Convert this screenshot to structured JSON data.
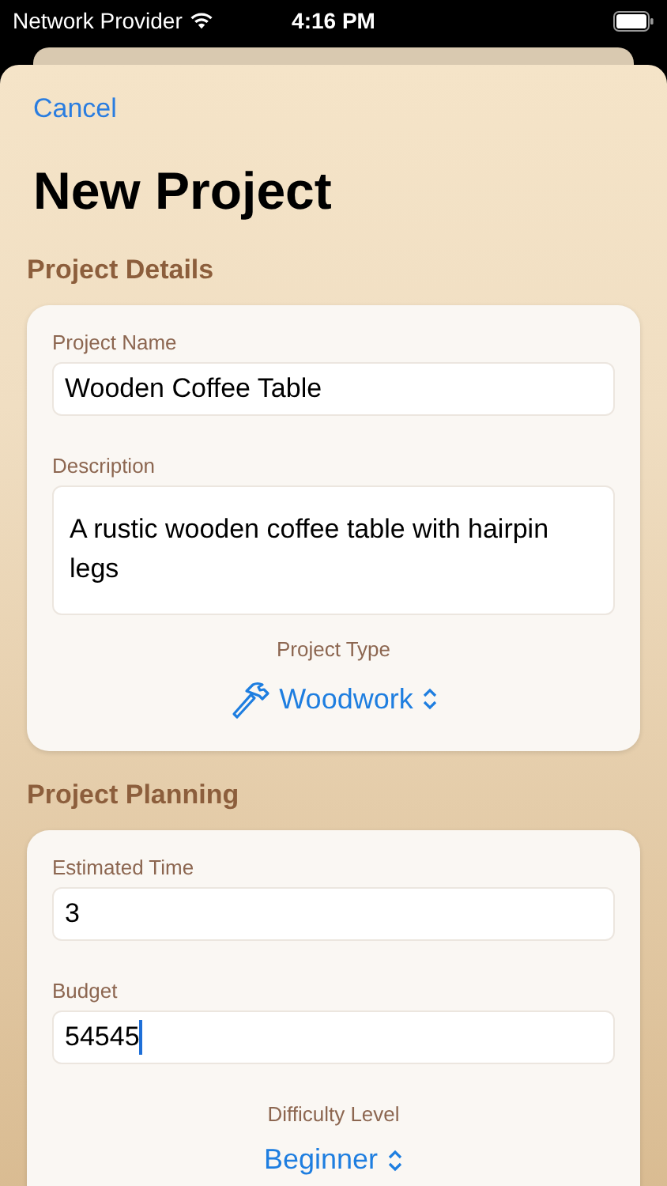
{
  "status_bar": {
    "carrier": "Network Provider",
    "time": "4:16 PM"
  },
  "nav": {
    "cancel": "Cancel",
    "title": "New Project"
  },
  "sections": [
    {
      "title": "Project Details",
      "items": [
        {
          "kind": "field",
          "label": "Project Name",
          "value": "Wooden Coffee Table",
          "focused": false
        },
        {
          "kind": "textarea",
          "label": "Description",
          "value": "A rustic wooden coffee table with hairpin legs",
          "focused": false
        },
        {
          "kind": "icon-picker",
          "label": "Project Type",
          "value": "Woodwork"
        }
      ]
    },
    {
      "title": "Project Planning",
      "items": [
        {
          "kind": "field",
          "label": "Estimated Time",
          "value": "3",
          "focused": false
        },
        {
          "kind": "field",
          "label": "Budget",
          "value": "54545",
          "focused": true
        },
        {
          "kind": "picker",
          "label": "Difficulty Level",
          "value": "Beginner"
        }
      ]
    }
  ]
}
